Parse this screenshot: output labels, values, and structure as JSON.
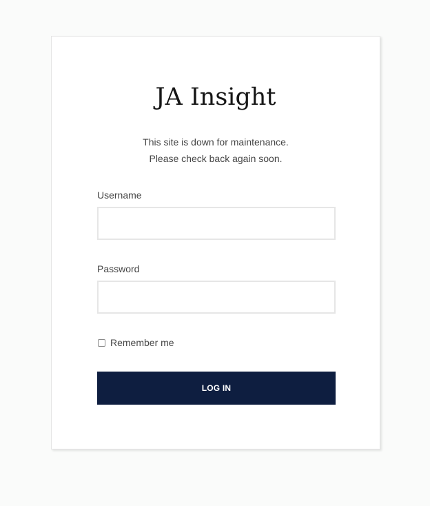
{
  "site": {
    "logo_text": "JA Insight"
  },
  "notice": {
    "line1": "This site is down for maintenance.",
    "line2": "Please check back again soon."
  },
  "form": {
    "username_label": "Username",
    "username_value": "",
    "password_label": "Password",
    "password_value": "",
    "remember_label": "Remember me",
    "remember_checked": false,
    "login_label": "LOG IN"
  },
  "colors": {
    "page_background": "#fafbfa",
    "card_background": "#ffffff",
    "button_background": "#0e1e40",
    "button_text": "#ffffff",
    "text": "#444444",
    "input_border": "#e6e6e6"
  }
}
